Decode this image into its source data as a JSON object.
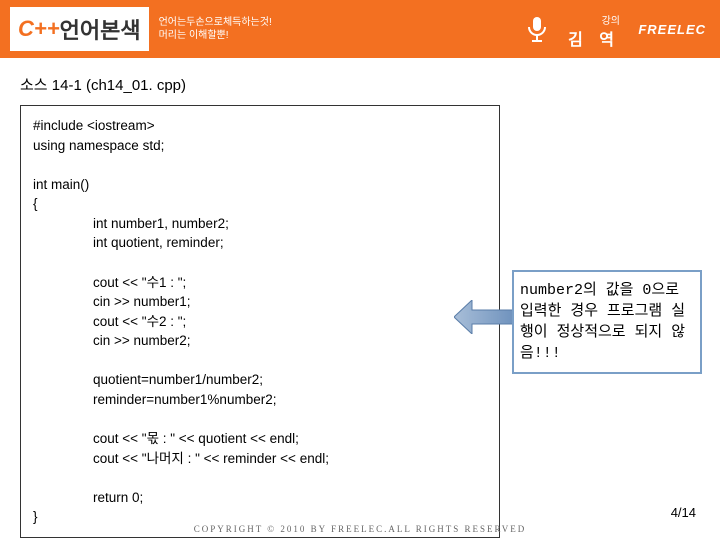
{
  "header": {
    "logo_prefix": "C++",
    "logo_main": "언어본색",
    "subline1": "언어는두손으로체득하는것!",
    "subline2": "머리는 이해할뿐!",
    "lecture_label": "강의",
    "lecturer": "김 역",
    "brand": "FREELEC"
  },
  "title": "소스 14-1 (ch14_01. cpp)",
  "code": {
    "l1": "#include <iostream>",
    "l2": "using namespace std;",
    "l3": "int main()",
    "l4": "{",
    "l5": "int number1, number2;",
    "l6": "int quotient, reminder;",
    "l7": "cout << \"수1 : \";",
    "l8": "cin  >> number1;",
    "l9": "cout << \"수2 : \";",
    "l10": "cin  >> number2;",
    "l11": "quotient=number1/number2;",
    "l12": "reminder=number1%number2;",
    "l13": "cout << \"몫 : \" << quotient << endl;",
    "l14": "cout << \"나머지 : \" << reminder << endl;",
    "l15": "return 0;",
    "l16": "}"
  },
  "callout": "number2의 값을 0으로 입력한 경우 프로그램 실행이 정상적으로 되지 않음!!!",
  "footer": "COPYRIGHT © 2010 BY FREELEC.ALL RIGHTS RESERVED",
  "page": "4/14"
}
